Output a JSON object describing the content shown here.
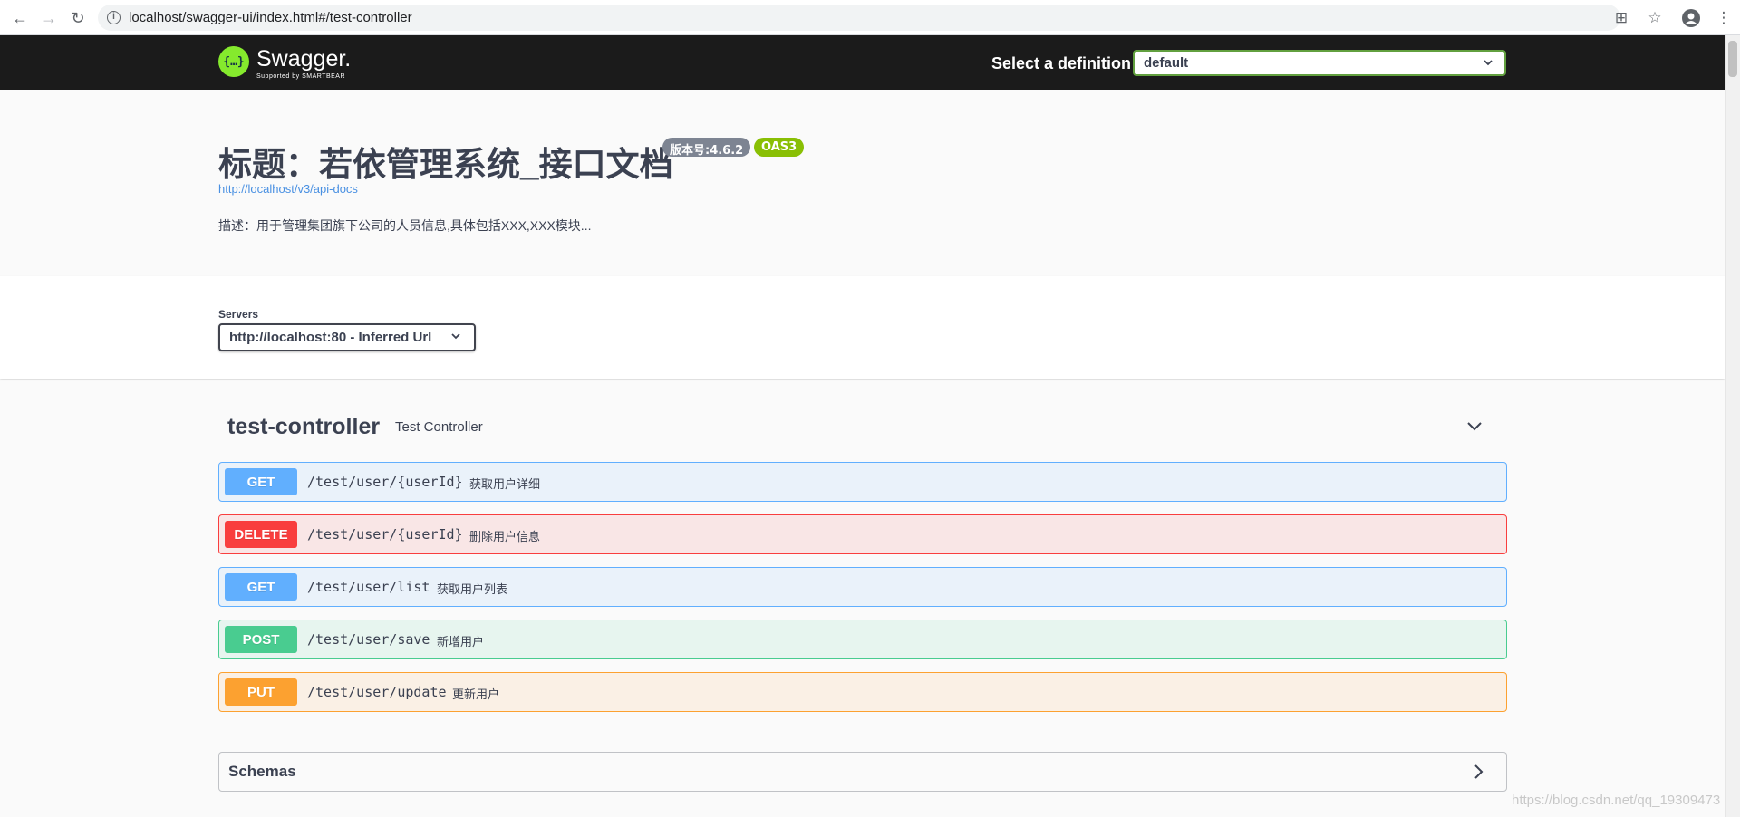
{
  "browser": {
    "url": "localhost/swagger-ui/index.html#/test-controller"
  },
  "topbar": {
    "logo_icon": "{…}",
    "logo_text": "Swagger.",
    "logo_sub": "Supported by SMARTBEAR",
    "definition_label": "Select a definition",
    "definition_value": "default"
  },
  "info": {
    "title": "标题：若依管理系统_接口文档",
    "version_badge": "版本号:4.6.2",
    "oas_badge": "OAS3",
    "link": "http://localhost/v3/api-docs",
    "description": "描述：用于管理集团旗下公司的人员信息,具体包括XXX,XXX模块..."
  },
  "servers": {
    "label": "Servers",
    "value": "http://localhost:80 - Inferred Url"
  },
  "tag": {
    "name": "test-controller",
    "description": "Test Controller"
  },
  "operations": [
    {
      "method": "GET",
      "path": "/test/user/{userId}",
      "summary": "获取用户详细"
    },
    {
      "method": "DELETE",
      "path": "/test/user/{userId}",
      "summary": "删除用户信息"
    },
    {
      "method": "GET",
      "path": "/test/user/list",
      "summary": "获取用户列表"
    },
    {
      "method": "POST",
      "path": "/test/user/save",
      "summary": "新增用户"
    },
    {
      "method": "PUT",
      "path": "/test/user/update",
      "summary": "更新用户"
    }
  ],
  "schemas": {
    "title": "Schemas"
  },
  "watermark": "https://blog.csdn.net/qq_19309473",
  "colors": {
    "get": "#61affe",
    "delete": "#f93e3e",
    "post": "#49cc90",
    "put": "#fca130",
    "accent": "#89bf04"
  }
}
